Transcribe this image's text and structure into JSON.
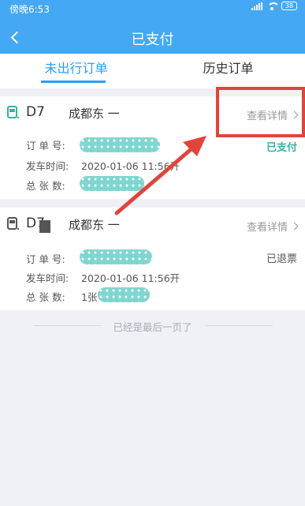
{
  "status_bar": {
    "time": "傍晚6:53",
    "battery": "38"
  },
  "header": {
    "title": "已支付"
  },
  "tabs": [
    {
      "label": "未出行订单",
      "active": true
    },
    {
      "label": "历史订单",
      "active": false
    }
  ],
  "orders": [
    {
      "train_no": "D7",
      "station": "成都东 一",
      "detail_label": "查看详情",
      "status": "已支付",
      "fields": {
        "order_no_label": "订 单 号:",
        "depart_time_label": "发车时间:",
        "depart_time_value": "2020-01-06  11:56开",
        "count_label": "总 张 数:",
        "count_value": ""
      }
    },
    {
      "train_no": "D7",
      "station": "成都东 一",
      "detail_label": "查看详情",
      "status": "已退票",
      "fields": {
        "order_no_label": "订 单 号:",
        "depart_time_label": "发车时间:",
        "depart_time_value": "2020-01-06  11:56开",
        "count_label": "总 张 数:",
        "count_value": "1张"
      }
    }
  ],
  "footer": {
    "end_note": "已经是最后一页了"
  },
  "colors": {
    "header": "#44a8f4",
    "accent": "#2d9ff5",
    "paid": "#3ab0a2",
    "annotation": "#e0453c"
  }
}
